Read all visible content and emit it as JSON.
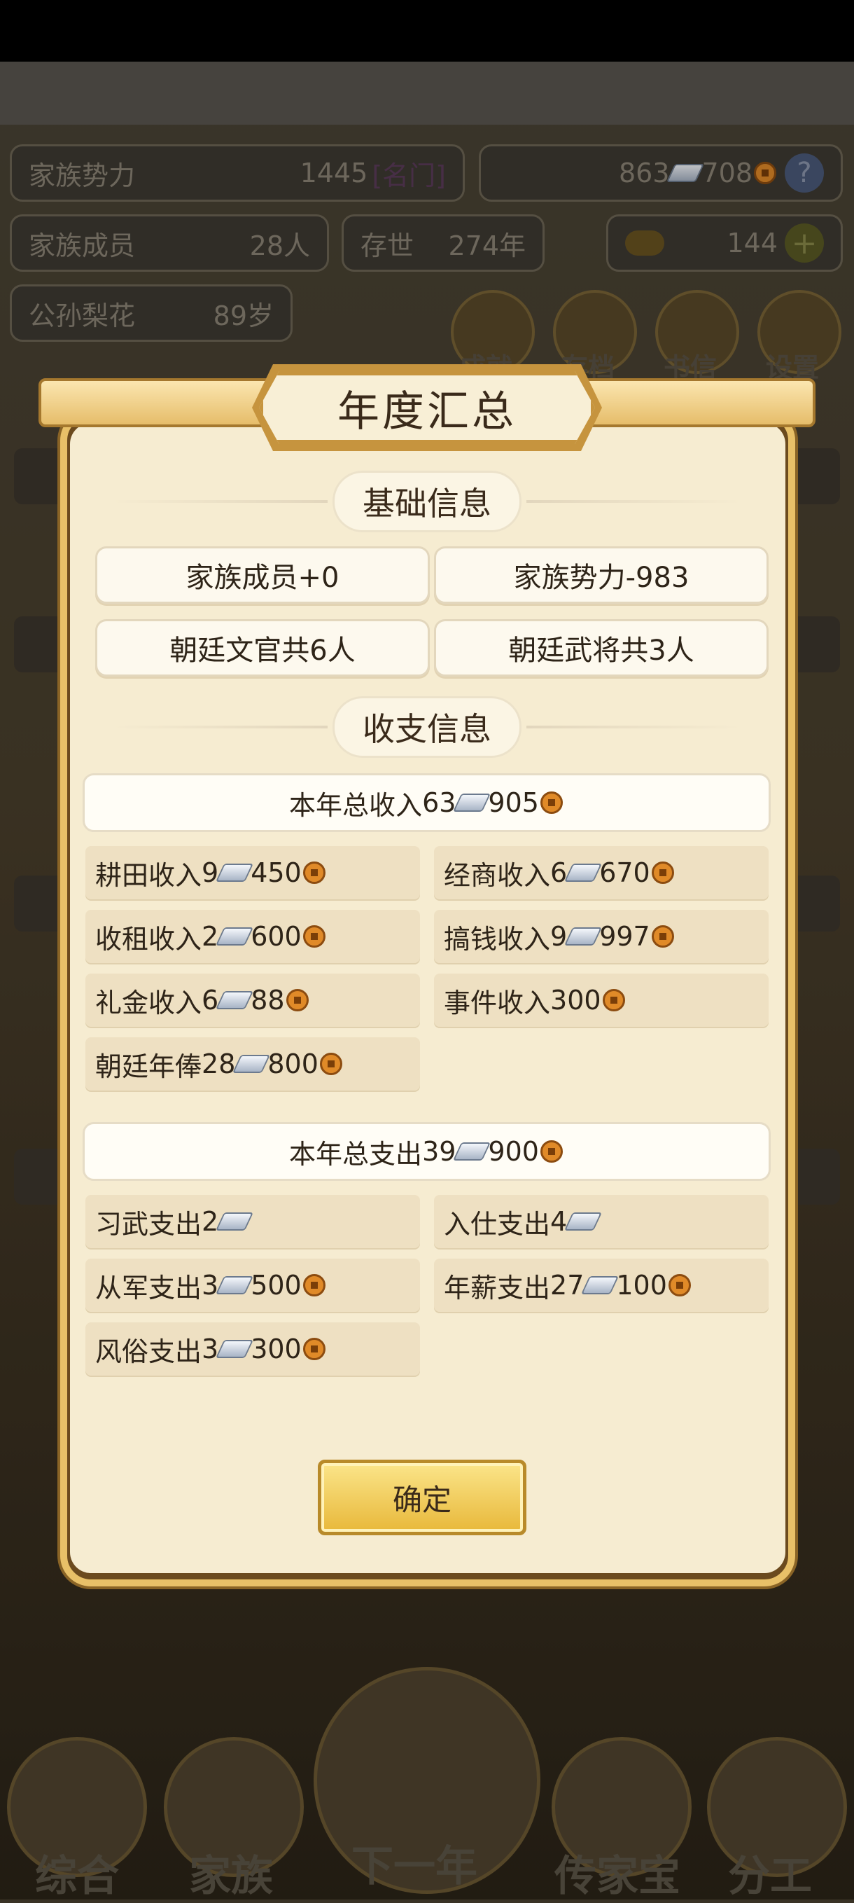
{
  "background": {
    "family_power_label": "家族势力",
    "family_power_value": "1445",
    "family_power_rank": "[名门]",
    "resources_silver": "863",
    "resources_coin": "708",
    "family_members_label": "家族成员",
    "family_members_value": "28人",
    "existence_label": "存世",
    "existence_value": "274年",
    "gold_value": "144",
    "person_name": "公孙梨花",
    "person_age": "89岁",
    "shortcuts": [
      "成就",
      "存档",
      "书信",
      "设置"
    ],
    "bottom_nav": [
      "综合",
      "家族",
      "下一年",
      "传家宝",
      "分工"
    ]
  },
  "dialog": {
    "title": "年度汇总",
    "basic_section_title": "基础信息",
    "basic_items": [
      "家族成员+0",
      "家族势力-983",
      "朝廷文官共6人",
      "朝廷武将共3人"
    ],
    "finance_section_title": "收支信息",
    "income_total": {
      "label": "本年总收入 ",
      "silver": "63",
      "coin": "905"
    },
    "income_items": [
      {
        "label": "耕田收入",
        "silver": "9",
        "coin": "450"
      },
      {
        "label": "经商收入",
        "silver": "6",
        "coin": "670"
      },
      {
        "label": "收租收入",
        "silver": "2",
        "coin": "600"
      },
      {
        "label": "搞钱收入",
        "silver": "9",
        "coin": "997"
      },
      {
        "label": "礼金收入",
        "silver": "6",
        "coin": "88"
      },
      {
        "label": "事件收入",
        "silver": "",
        "coin": "300"
      },
      {
        "label": "朝廷年俸",
        "silver": "28",
        "coin": "800"
      }
    ],
    "expense_total": {
      "label": "本年总支出",
      "silver": "39",
      "coin": "900"
    },
    "expense_items": [
      {
        "label": "习武支出",
        "silver": "2",
        "coin": ""
      },
      {
        "label": "入仕支出",
        "silver": "4",
        "coin": ""
      },
      {
        "label": "从军支出",
        "silver": "3",
        "coin": "500"
      },
      {
        "label": "年薪支出",
        "silver": "27",
        "coin": "100"
      },
      {
        "label": "风俗支出",
        "silver": "3",
        "coin": "300"
      }
    ],
    "confirm_label": "确定"
  },
  "colors": {
    "accent_gold": "#e8c068",
    "panel_bg": "#f6ecd1",
    "cell_bg": "#eee0c2"
  },
  "icons": {
    "silver": "silver-ingot-icon",
    "coin": "copper-coin-icon"
  }
}
